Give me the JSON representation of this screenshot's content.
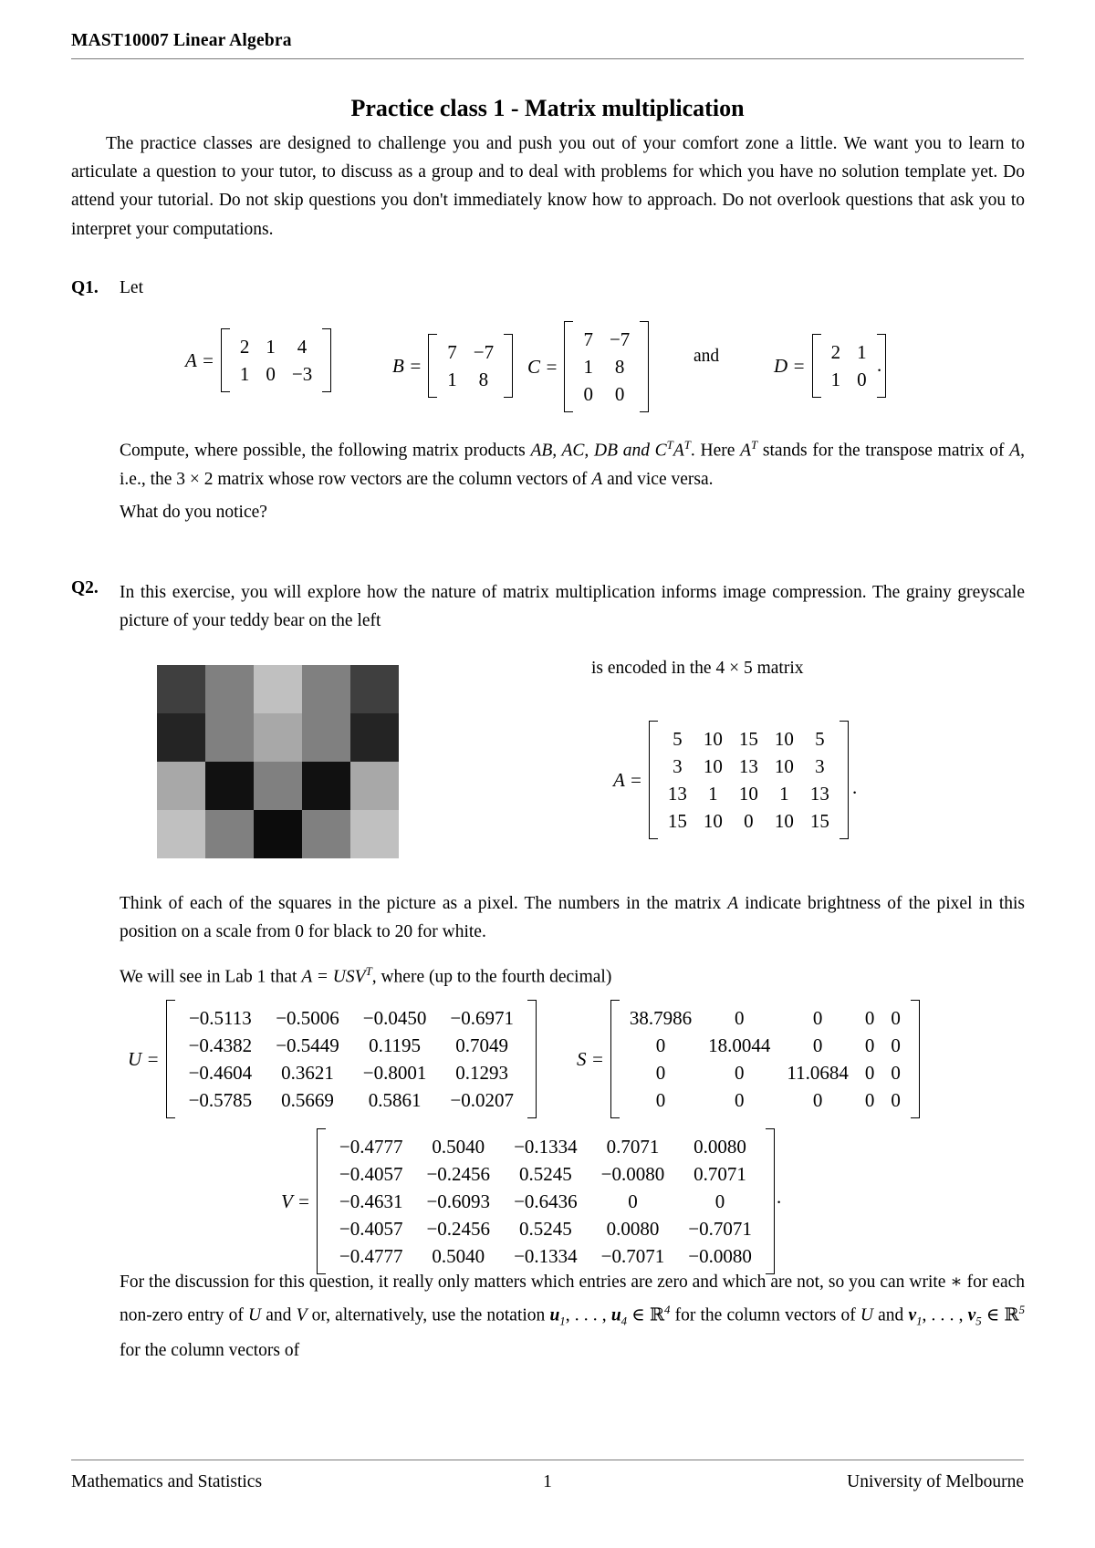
{
  "header": {
    "running_head": "MAST10007 Linear Algebra"
  },
  "title": "Practice class 1 - Matrix multiplication",
  "intro": "The practice classes are designed to challenge you and push you out of your comfort zone a little. We want you to learn to articulate a question to your tutor, to discuss as a group and to deal with problems for which you have no solution template yet. Do attend your tutorial. Do not skip questions you don't immediately know how to approach. Do not overlook questions that ask you to interpret your computations.",
  "q1": {
    "label": "Q1.",
    "lead": "Let",
    "and_word": "and",
    "matrices": {
      "A": {
        "name": "A",
        "rows": [
          [
            "2",
            "1",
            "4"
          ],
          [
            "1",
            "0",
            "−3"
          ]
        ]
      },
      "B": {
        "name": "B",
        "rows": [
          [
            "7",
            "−7"
          ],
          [
            "1",
            "8"
          ]
        ]
      },
      "C": {
        "name": "C",
        "rows": [
          [
            "7",
            "−7"
          ],
          [
            "1",
            "8"
          ],
          [
            "0",
            "0"
          ]
        ]
      },
      "D": {
        "name": "D",
        "rows": [
          [
            "2",
            "1"
          ],
          [
            "1",
            "0"
          ]
        ]
      }
    },
    "compute_text_1": "Compute, where possible, the following matrix products ",
    "products": "AB, AC, DB and C",
    "compute_text_2": ". Here ",
    "compute_text_3": " stands for the transpose matrix of ",
    "compute_text_4": ", i.e., the 3 × 2 matrix whose row vectors are the column vectors of ",
    "compute_text_5": " and vice versa.",
    "notice": "What do you notice?"
  },
  "q2": {
    "label": "Q2.",
    "intro": "In this exercise, you will explore how the nature of matrix multiplication informs image compression. The grainy greyscale picture of your teddy bear on the left",
    "encoded_line": "is encoded in the 4 × 5 matrix",
    "matrix_A": {
      "name": "A",
      "rows": [
        [
          "5",
          "10",
          "15",
          "10",
          "5"
        ],
        [
          "3",
          "10",
          "13",
          "10",
          "3"
        ],
        [
          "13",
          "1",
          "10",
          "1",
          "13"
        ],
        [
          "15",
          "10",
          "0",
          "10",
          "15"
        ]
      ]
    },
    "think_text_1": "Think of each of the squares in the picture as a pixel. The numbers in the matrix ",
    "think_text_2": " indicate brightness of the pixel in this position on a scale from 0 for black to 20 for white.",
    "lab_text_1": "We will see in Lab 1 that ",
    "lab_text_2": ", where (up to the fourth decimal)",
    "matrix_U": {
      "name": "U",
      "rows": [
        [
          "−0.5113",
          "−0.5006",
          "−0.0450",
          "−0.6971"
        ],
        [
          "−0.4382",
          "−0.5449",
          "0.1195",
          "0.7049"
        ],
        [
          "−0.4604",
          "0.3621",
          "−0.8001",
          "0.1293"
        ],
        [
          "−0.5785",
          "0.5669",
          "0.5861",
          "−0.0207"
        ]
      ]
    },
    "matrix_S": {
      "name": "S",
      "rows": [
        [
          "38.7986",
          "0",
          "0",
          "0",
          "0"
        ],
        [
          "0",
          "18.0044",
          "0",
          "0",
          "0"
        ],
        [
          "0",
          "0",
          "11.0684",
          "0",
          "0"
        ],
        [
          "0",
          "0",
          "0",
          "0",
          "0"
        ]
      ]
    },
    "matrix_V": {
      "name": "V",
      "rows": [
        [
          "−0.4777",
          "0.5040",
          "−0.1334",
          "0.7071",
          "0.0080"
        ],
        [
          "−0.4057",
          "−0.2456",
          "0.5245",
          "−0.0080",
          "0.7071"
        ],
        [
          "−0.4631",
          "−0.6093",
          "−0.6436",
          "0",
          "0"
        ],
        [
          "−0.4057",
          "−0.2456",
          "0.5245",
          "0.0080",
          "−0.7071"
        ],
        [
          "−0.4777",
          "0.5040",
          "−0.1334",
          "−0.7071",
          "−0.0080"
        ]
      ]
    },
    "final_text_1": "For the discussion for this question, it really only matters which entries are zero and which are not, so you can write ∗ for each non-zero entry of ",
    "final_text_2": " and ",
    "final_text_3": " or, alternatively, use the notation ",
    "final_text_4": " for the column vectors of ",
    "final_text_5": " and ",
    "final_text_6": " for the column vectors of"
  },
  "image": {
    "name": "teddy-bear-pixel-grid",
    "rows": 4,
    "cols": 5,
    "scale_min": 0,
    "scale_max": 20,
    "values": [
      [
        5,
        10,
        15,
        10,
        5
      ],
      [
        3,
        10,
        13,
        10,
        3
      ],
      [
        13,
        1,
        10,
        1,
        13
      ],
      [
        15,
        10,
        0,
        10,
        15
      ]
    ]
  },
  "footer": {
    "left": "Mathematics and Statistics",
    "center": "1",
    "right": "University of Melbourne"
  }
}
